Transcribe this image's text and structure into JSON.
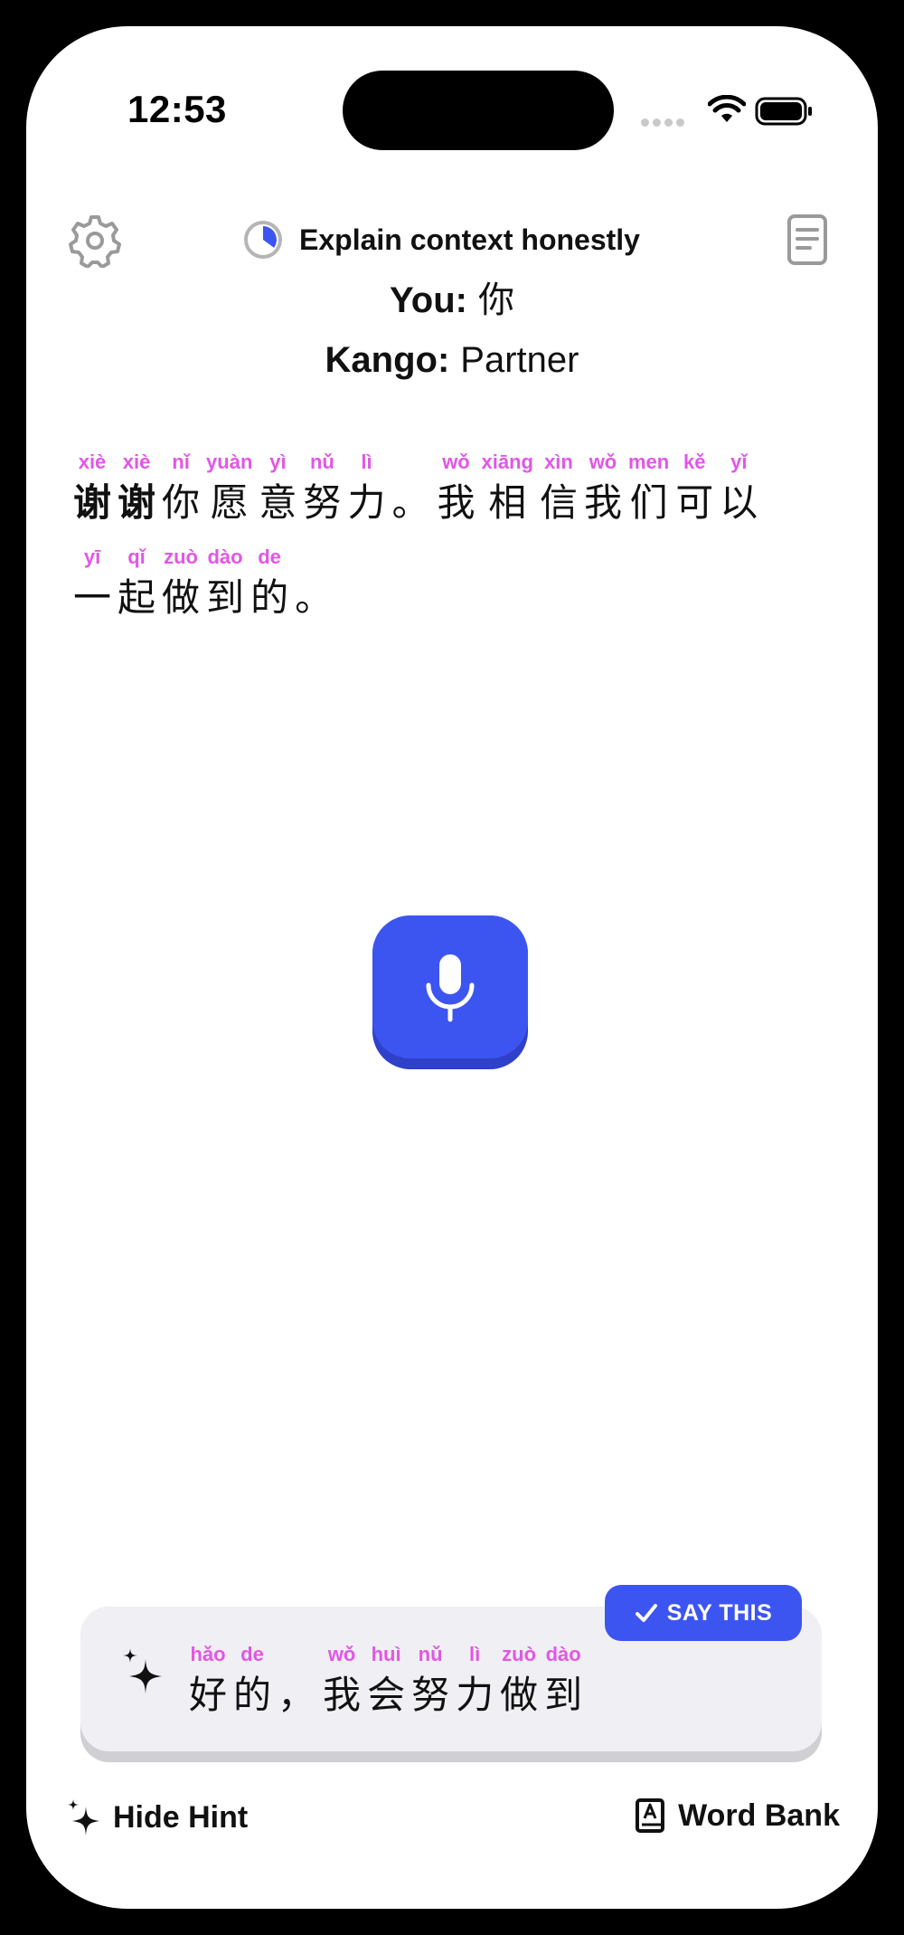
{
  "status_bar": {
    "time": "12:53"
  },
  "header": {
    "goal_text": "Explain context honestly",
    "goal_progress": 0.35
  },
  "roles": [
    {
      "label": "You:",
      "value": "你"
    },
    {
      "label": "Kango:",
      "value": "Partner"
    }
  ],
  "message": {
    "rows": [
      [
        {
          "py": "xiè",
          "hz": "谢",
          "bold": true
        },
        {
          "py": "xiè",
          "hz": "谢",
          "bold": true
        },
        {
          "py": "nǐ",
          "hz": "你"
        },
        {
          "py": "yuàn",
          "hz": "愿"
        },
        {
          "py": "yì",
          "hz": "意"
        },
        {
          "py": "nǔ",
          "hz": "努"
        },
        {
          "py": "lì",
          "hz": "力"
        },
        {
          "p": "。"
        },
        {
          "py": "wǒ",
          "hz": "我"
        },
        {
          "py": "xiāng",
          "hz": "相"
        },
        {
          "py": "xìn",
          "hz": "信"
        },
        {
          "py": "wǒ",
          "hz": "我"
        },
        {
          "py": "men",
          "hz": "们"
        },
        {
          "py": "kě",
          "hz": "可"
        },
        {
          "py": "yǐ",
          "hz": "以"
        }
      ],
      [
        {
          "py": "yī",
          "hz": "一"
        },
        {
          "py": "qǐ",
          "hz": "起"
        },
        {
          "py": "zuò",
          "hz": "做"
        },
        {
          "py": "dào",
          "hz": "到"
        },
        {
          "py": "de",
          "hz": "的"
        },
        {
          "p": "。"
        }
      ]
    ]
  },
  "hint": {
    "say_this_label": "SAY THIS",
    "tokens": [
      {
        "py": "hǎo",
        "hz": "好"
      },
      {
        "py": "de",
        "hz": "的"
      },
      {
        "p": "，"
      },
      {
        "py": "wǒ",
        "hz": "我"
      },
      {
        "py": "huì",
        "hz": "会"
      },
      {
        "py": "nǔ",
        "hz": "努"
      },
      {
        "py": "lì",
        "hz": "力"
      },
      {
        "py": "zuò",
        "hz": "做"
      },
      {
        "py": "dào",
        "hz": "到"
      }
    ]
  },
  "bottom_bar": {
    "hide_hint_label": "Hide Hint",
    "word_bank_label": "Word Bank"
  },
  "colors": {
    "accent": "#3d55f0",
    "pinyin": "#e256e6"
  }
}
